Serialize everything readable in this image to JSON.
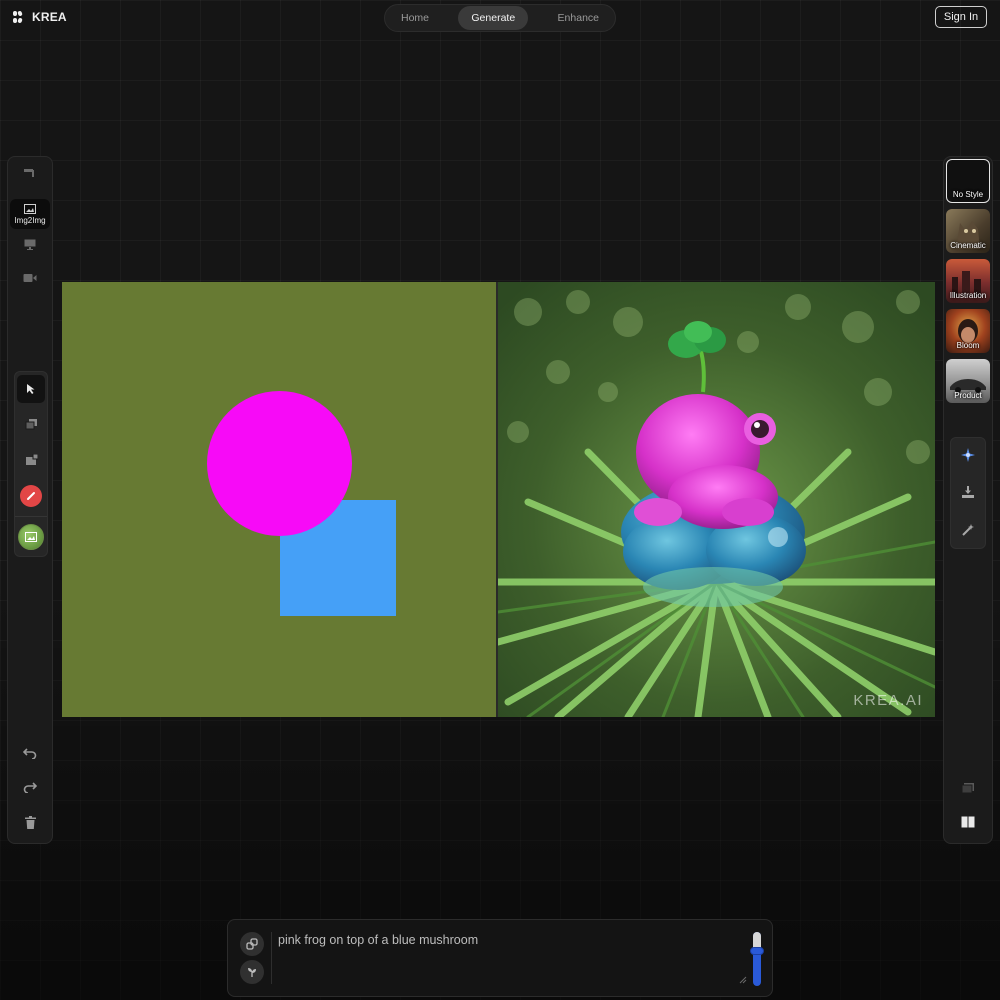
{
  "app": {
    "logo_text": "KREA"
  },
  "nav": {
    "tabs": [
      {
        "label": "Home"
      },
      {
        "label": "Generate"
      },
      {
        "label": "Enhance"
      }
    ],
    "active": "Generate"
  },
  "header": {
    "signin_label": "Sign In"
  },
  "left_sidebar": {
    "modes": [
      {
        "name": "paint-mode",
        "icon": "brush-icon",
        "label": ""
      },
      {
        "name": "img2img-mode",
        "icon": "image-icon",
        "label": "Img2Img"
      },
      {
        "name": "screen-mode",
        "icon": "monitor-icon",
        "label": ""
      },
      {
        "name": "video-mode",
        "icon": "video-icon",
        "label": ""
      }
    ],
    "tools": [
      "cursor-icon",
      "layers-icon",
      "add-image-icon",
      "eraser-icon",
      "image-thumbnail-icon"
    ],
    "history": [
      "undo-icon",
      "redo-icon",
      "trash-icon"
    ]
  },
  "right_sidebar": {
    "styles": [
      {
        "label": "No Style"
      },
      {
        "label": "Cinematic"
      },
      {
        "label": "Illustration"
      },
      {
        "label": "Bloom"
      },
      {
        "label": "Product"
      }
    ],
    "actions": [
      "enhance-sparkle-icon",
      "download-icon",
      "magic-wand-icon"
    ],
    "view": [
      "stack-view-icon",
      "split-view-icon"
    ]
  },
  "canvas": {
    "shapes": {
      "background_color": "#677a33",
      "circle_color": "#f70af7",
      "square_color": "#45a0f7"
    },
    "output_watermark": "KREA.AI"
  },
  "prompt": {
    "text": "pink frog on top of a blue mushroom",
    "strength": 0.65
  },
  "colors": {
    "accent": "#2a5ad8",
    "background": "#151515"
  }
}
